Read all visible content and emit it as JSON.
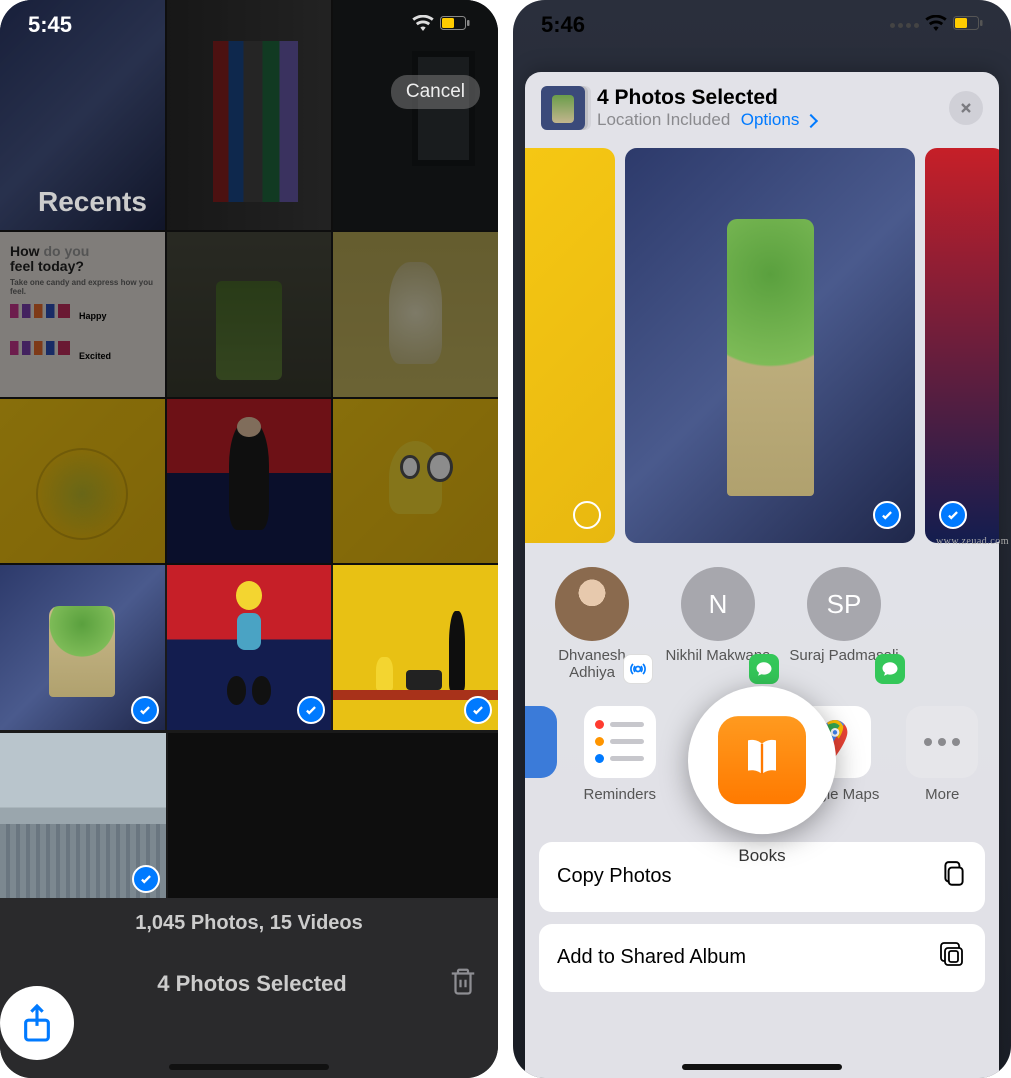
{
  "left": {
    "status_time": "5:45",
    "album_label": "Recents",
    "cancel": "Cancel",
    "summary": "1,045 Photos, 15 Videos",
    "selected_text": "4 Photos Selected",
    "grid": {
      "row2_quote_big": "How do you feel today?",
      "row2_quote_small": "Take one candy and express how you feel.",
      "row2_happy": "Happy",
      "row2_excited": "Excited"
    }
  },
  "right": {
    "status_time": "5:46",
    "sheet_title": "4 Photos Selected",
    "sheet_sub": "Location Included",
    "sheet_options": "Options",
    "contacts": [
      {
        "name": "Dhvanesh Adhiya"
      },
      {
        "name": "Nikhil Makwana",
        "initials": "N"
      },
      {
        "name": "Suraj Padmasali",
        "initials": "SP"
      }
    ],
    "apps": {
      "reminders": "Reminders",
      "books": "Books",
      "gmaps": "Google Maps",
      "more": "More"
    },
    "actions": {
      "copy": "Copy Photos",
      "add_shared": "Add to Shared Album"
    }
  },
  "watermark": "www.zeuad.com"
}
